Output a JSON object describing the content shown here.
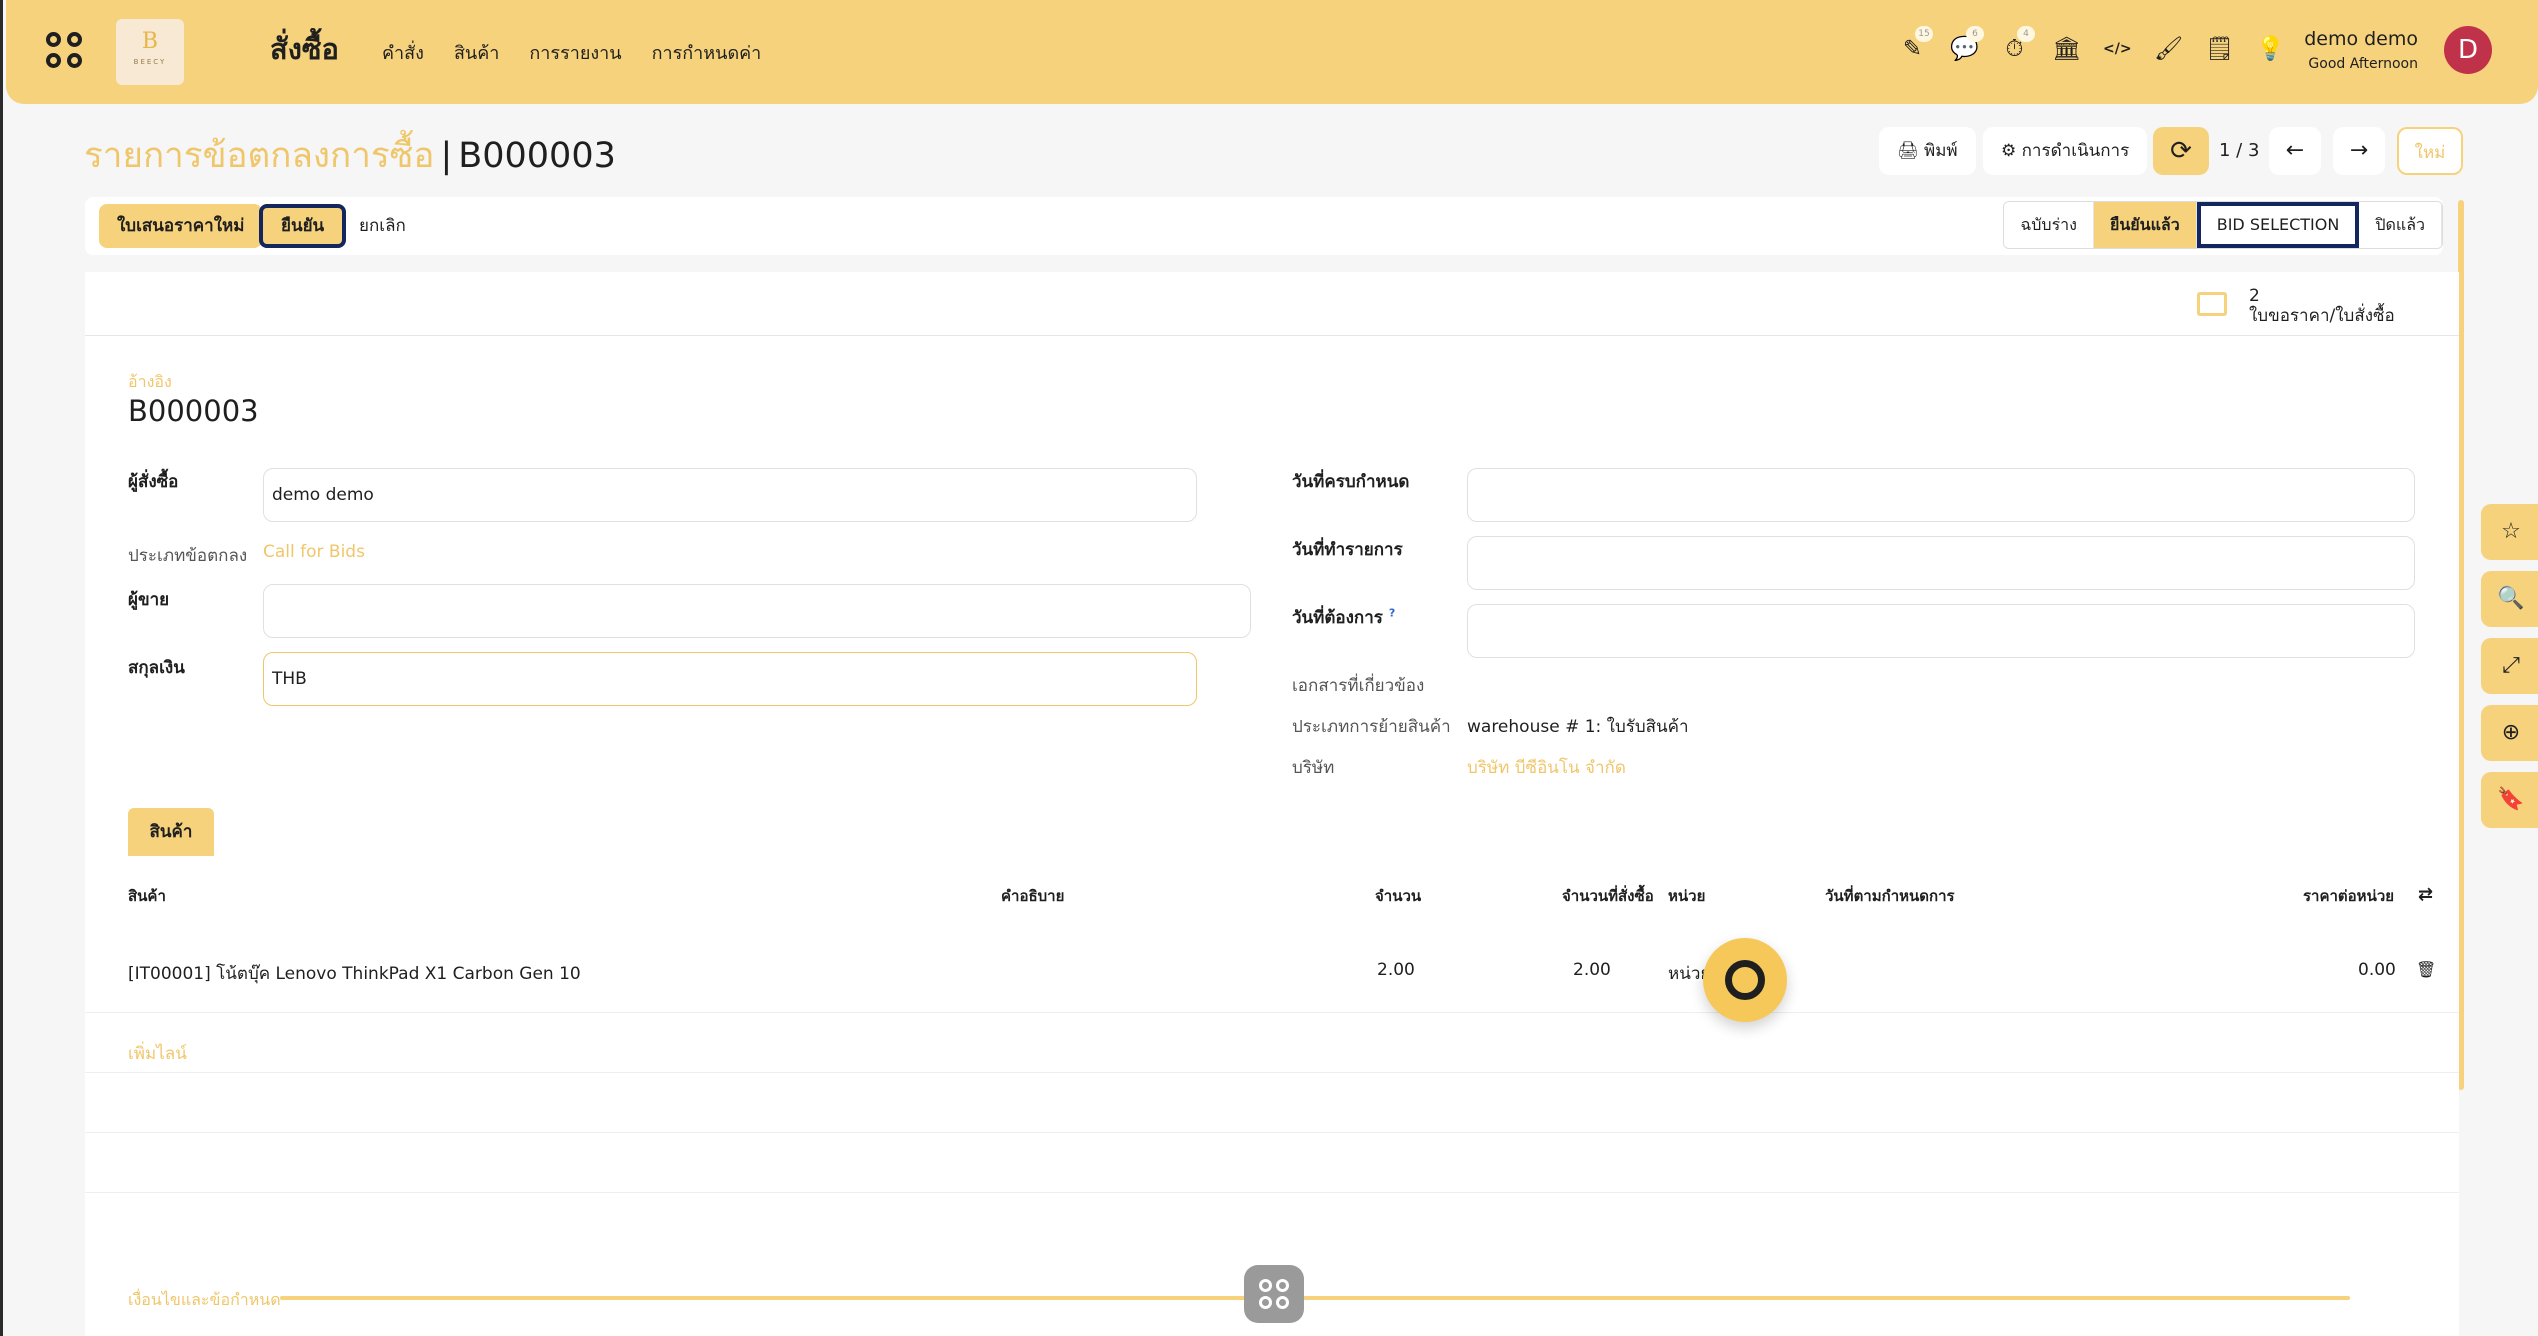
{
  "topbar": {
    "app_title": "สั่งซื้อ",
    "logo_letter": "B",
    "logo_text": "BEECY",
    "menu": [
      "คำสั่ง",
      "สินค้า",
      "การรายงาน",
      "การกำหนดค่า"
    ],
    "icons": [
      {
        "name": "activity-icon",
        "glyph": "✎",
        "badge": "15"
      },
      {
        "name": "messages-icon",
        "glyph": "💬",
        "badge": "6"
      },
      {
        "name": "timer-icon",
        "glyph": "⏱",
        "badge": "4"
      },
      {
        "name": "bank-icon",
        "glyph": "🏛",
        "badge": ""
      },
      {
        "name": "code-icon",
        "glyph": "</>",
        "badge": ""
      },
      {
        "name": "paint-icon",
        "glyph": "🖌",
        "badge": ""
      },
      {
        "name": "note-icon",
        "glyph": "🗒",
        "badge": ""
      },
      {
        "name": "bulb-icon",
        "glyph": "💡",
        "badge": ""
      }
    ],
    "user_name": "demo demo",
    "greeting": "Good Afternoon",
    "avatar_letter": "D"
  },
  "breadcrumb": {
    "parent": "รายการข้อตกลงการซื้อ",
    "current": "B000003"
  },
  "controls": {
    "print": "🖨 พิมพ์",
    "action": "⚙ การดำเนินการ",
    "refresh": "⟳",
    "pager": "1 / 3",
    "prev": "←",
    "next": "→",
    "new": "ใหม่"
  },
  "statusbar": {
    "new_quote": "ใบเสนอราคาใหม่",
    "confirm": "ยืนยัน",
    "cancel": "ยกเลิก",
    "stages": [
      "ฉบับร่าง",
      "ยืนยันแล้ว",
      "BID SELECTION",
      "ปิดแล้ว"
    ]
  },
  "smart_button": {
    "count": "2",
    "label": "ใบขอราคา/ใบสั่งซื้อ"
  },
  "form": {
    "ref_label": "อ้างอิง",
    "ref_value": "B000003",
    "buyer_label": "ผู้สั่งซื้อ",
    "buyer_value": "demo demo",
    "agreement_type_label": "ประเภทข้อตกลง",
    "agreement_type_value": "Call for Bids",
    "vendor_label": "ผู้ขาย",
    "vendor_value": "",
    "currency_label": "สกุลเงิน",
    "currency_value": "THB",
    "deadline_label": "วันที่ครบกำหนด",
    "order_date_label": "วันที่ทำรายการ",
    "required_date_label": "วันที่ต้องการ",
    "required_date_hint": "?",
    "source_doc_label": "เอกสารที่เกี่ยวข้อง",
    "picking_type_label": "ประเภทการย้ายสินค้า",
    "picking_type_value": "warehouse # 1: ใบรับสินค้า",
    "company_label": "บริษัท",
    "company_value": "บริษัท บีซีอินโน จำกัด"
  },
  "products": {
    "tab_label": "สินค้า",
    "columns": [
      "สินค้า",
      "คำอธิบาย",
      "จำนวน",
      "จำนวนที่สั่งซื้อ",
      "หน่วย",
      "วันที่ตามกำหนดการ",
      "ราคาต่อหน่วย"
    ],
    "rows": [
      {
        "product": "[IT00001] โน้ตบุ๊ค Lenovo ThinkPad X1 Carbon Gen 10",
        "description": "",
        "qty": "2.00",
        "ordered": "2.00",
        "uom": "หน่วย",
        "schedule": "",
        "price": "0.00"
      }
    ],
    "add_line": "เพิ่มไลน์"
  },
  "terms_label": "เงื่อนไขและข้อกำหนด",
  "side_tools": [
    "☆",
    "🔍",
    "⤢",
    "⊕",
    "🔖"
  ],
  "colors": {
    "accent": "#f6d27d",
    "link": "#f0c66a",
    "highlight_border": "#13265d",
    "avatar": "#c0324a"
  }
}
